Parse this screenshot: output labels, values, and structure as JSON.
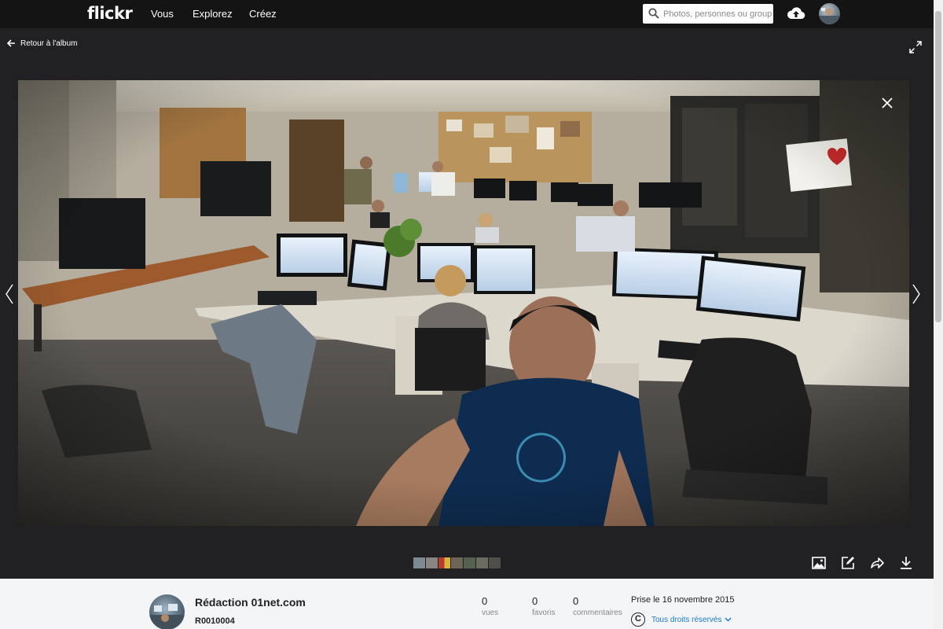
{
  "nav": {
    "logo": "flickr",
    "links": [
      "Vous",
      "Explorez",
      "Créez"
    ],
    "search_placeholder": "Photos, personnes ou groupes"
  },
  "photo_page": {
    "back_label": "Retour à l'album",
    "filmstrip_count": 7
  },
  "info": {
    "title": "Rédaction 01net.com",
    "photo_id": "R0010004",
    "stats": [
      {
        "value": "0",
        "label": "vues"
      },
      {
        "value": "0",
        "label": "favoris"
      },
      {
        "value": "0",
        "label": "commentaires"
      }
    ],
    "taken": "Prise le 16 novembre 2015",
    "license_symbol": "C",
    "license": "Tous droits réservés"
  },
  "colors": {
    "nav_bg": "#141414",
    "page_bg": "#212124",
    "info_bg": "#f3f5f6",
    "link_blue": "#1c7bd2"
  },
  "icons": [
    "search-icon",
    "upload-cloud-icon",
    "back-arrow-icon",
    "fullscreen-icon",
    "close-icon",
    "chevron-left-icon",
    "chevron-right-icon",
    "photo-icon",
    "edit-icon",
    "share-icon",
    "download-icon",
    "copyright-icon",
    "chevron-down-icon"
  ]
}
